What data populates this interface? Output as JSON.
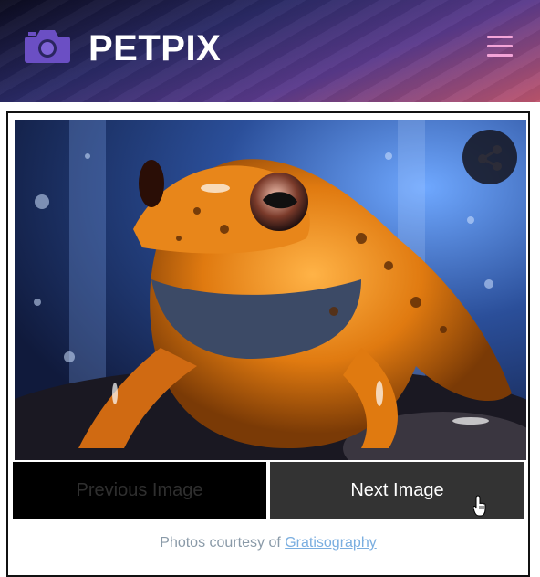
{
  "header": {
    "logo_icon": "camera-icon",
    "title": "PETPIX",
    "menu_icon": "hamburger-menu-icon"
  },
  "gallery": {
    "image_subject": "orange-frog-photo",
    "share_icon": "share-icon",
    "prev_label": "Previous Image",
    "next_label": "Next Image"
  },
  "footer": {
    "credit_prefix": "Photos courtesy of",
    "credit_link": "Gratisography"
  },
  "colors": {
    "menu_icon": "#f3a4d8",
    "prev_bg": "#000000",
    "next_bg": "#333333",
    "link": "#7aaee0"
  }
}
